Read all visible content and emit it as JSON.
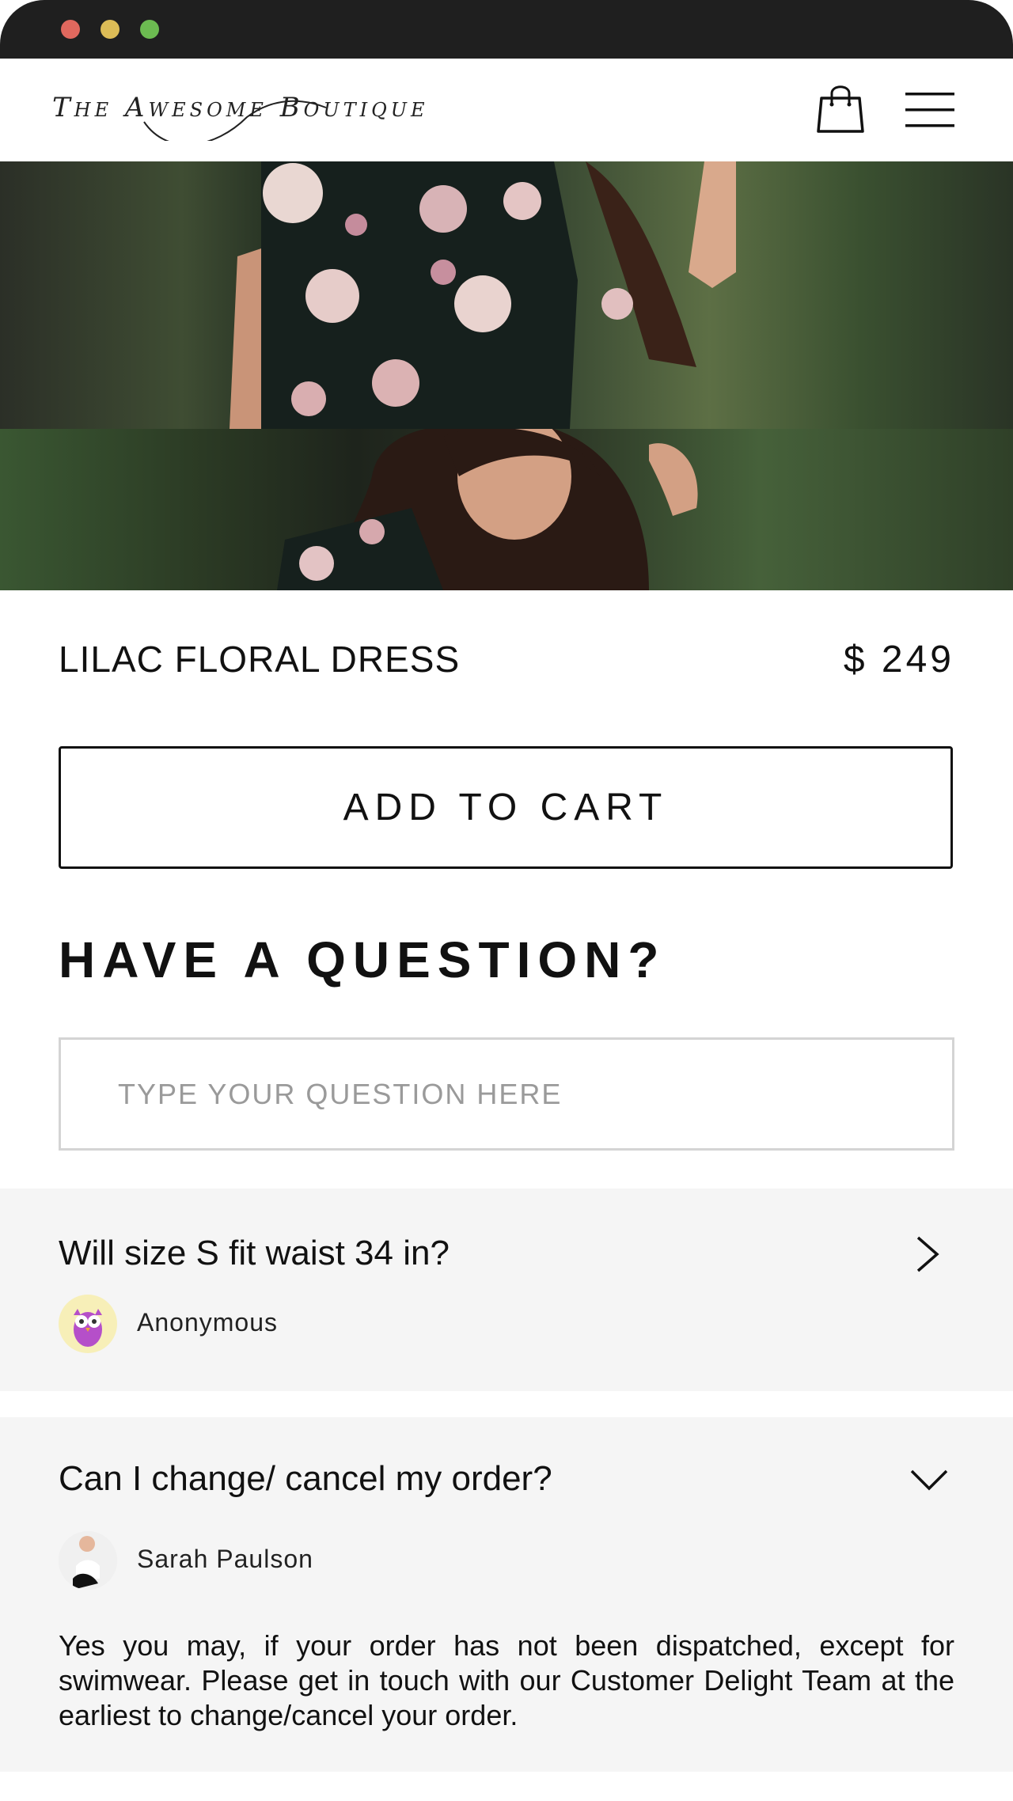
{
  "brand": {
    "name": "The Awesome Boutique"
  },
  "header": {
    "bag_icon": "shopping-bag-icon",
    "menu_icon": "hamburger-menu-icon"
  },
  "product": {
    "name": "LILAC FLORAL DRESS",
    "price": "$ 249",
    "add_to_cart_label": "ADD TO CART",
    "image": "model-wearing-floral-dress"
  },
  "qa": {
    "heading": "HAVE A QUESTION?",
    "input_placeholder": "TYPE YOUR QUESTION HERE",
    "items": [
      {
        "question": "Will size S fit waist 34 in?",
        "author": "Anonymous",
        "avatar": "owl-avatar",
        "expanded": false
      },
      {
        "question": "Can I change/ cancel my order?",
        "author": "Sarah Paulson",
        "avatar": "user-photo-avatar",
        "expanded": true,
        "answer": "Yes you may, if your order has not been dispatched, except for swimwear. Please get in touch with our Customer Delight Team at the earliest to change/cancel your order."
      }
    ]
  },
  "colors": {
    "window_bar": "#1f1f1f",
    "card_bg": "#f5f5f5",
    "text": "#111111",
    "input_border": "#d4d4d4"
  }
}
